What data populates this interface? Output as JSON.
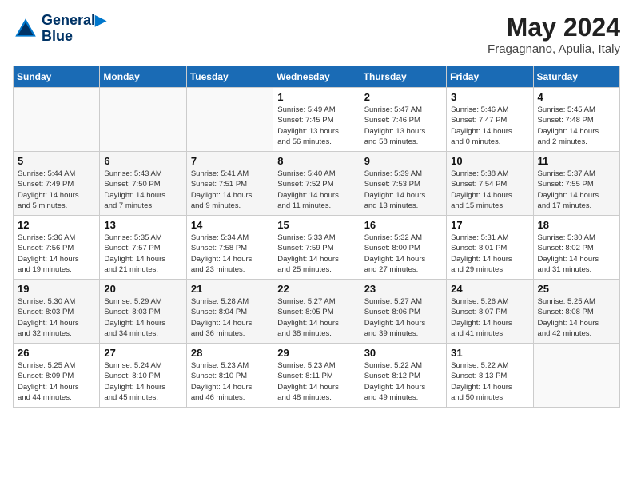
{
  "header": {
    "logo_line1": "General",
    "logo_line2": "Blue",
    "month": "May 2024",
    "location": "Fragagnano, Apulia, Italy"
  },
  "days_of_week": [
    "Sunday",
    "Monday",
    "Tuesday",
    "Wednesday",
    "Thursday",
    "Friday",
    "Saturday"
  ],
  "weeks": [
    [
      {
        "day": "",
        "info": ""
      },
      {
        "day": "",
        "info": ""
      },
      {
        "day": "",
        "info": ""
      },
      {
        "day": "1",
        "info": "Sunrise: 5:49 AM\nSunset: 7:45 PM\nDaylight: 13 hours\nand 56 minutes."
      },
      {
        "day": "2",
        "info": "Sunrise: 5:47 AM\nSunset: 7:46 PM\nDaylight: 13 hours\nand 58 minutes."
      },
      {
        "day": "3",
        "info": "Sunrise: 5:46 AM\nSunset: 7:47 PM\nDaylight: 14 hours\nand 0 minutes."
      },
      {
        "day": "4",
        "info": "Sunrise: 5:45 AM\nSunset: 7:48 PM\nDaylight: 14 hours\nand 2 minutes."
      }
    ],
    [
      {
        "day": "5",
        "info": "Sunrise: 5:44 AM\nSunset: 7:49 PM\nDaylight: 14 hours\nand 5 minutes."
      },
      {
        "day": "6",
        "info": "Sunrise: 5:43 AM\nSunset: 7:50 PM\nDaylight: 14 hours\nand 7 minutes."
      },
      {
        "day": "7",
        "info": "Sunrise: 5:41 AM\nSunset: 7:51 PM\nDaylight: 14 hours\nand 9 minutes."
      },
      {
        "day": "8",
        "info": "Sunrise: 5:40 AM\nSunset: 7:52 PM\nDaylight: 14 hours\nand 11 minutes."
      },
      {
        "day": "9",
        "info": "Sunrise: 5:39 AM\nSunset: 7:53 PM\nDaylight: 14 hours\nand 13 minutes."
      },
      {
        "day": "10",
        "info": "Sunrise: 5:38 AM\nSunset: 7:54 PM\nDaylight: 14 hours\nand 15 minutes."
      },
      {
        "day": "11",
        "info": "Sunrise: 5:37 AM\nSunset: 7:55 PM\nDaylight: 14 hours\nand 17 minutes."
      }
    ],
    [
      {
        "day": "12",
        "info": "Sunrise: 5:36 AM\nSunset: 7:56 PM\nDaylight: 14 hours\nand 19 minutes."
      },
      {
        "day": "13",
        "info": "Sunrise: 5:35 AM\nSunset: 7:57 PM\nDaylight: 14 hours\nand 21 minutes."
      },
      {
        "day": "14",
        "info": "Sunrise: 5:34 AM\nSunset: 7:58 PM\nDaylight: 14 hours\nand 23 minutes."
      },
      {
        "day": "15",
        "info": "Sunrise: 5:33 AM\nSunset: 7:59 PM\nDaylight: 14 hours\nand 25 minutes."
      },
      {
        "day": "16",
        "info": "Sunrise: 5:32 AM\nSunset: 8:00 PM\nDaylight: 14 hours\nand 27 minutes."
      },
      {
        "day": "17",
        "info": "Sunrise: 5:31 AM\nSunset: 8:01 PM\nDaylight: 14 hours\nand 29 minutes."
      },
      {
        "day": "18",
        "info": "Sunrise: 5:30 AM\nSunset: 8:02 PM\nDaylight: 14 hours\nand 31 minutes."
      }
    ],
    [
      {
        "day": "19",
        "info": "Sunrise: 5:30 AM\nSunset: 8:03 PM\nDaylight: 14 hours\nand 32 minutes."
      },
      {
        "day": "20",
        "info": "Sunrise: 5:29 AM\nSunset: 8:03 PM\nDaylight: 14 hours\nand 34 minutes."
      },
      {
        "day": "21",
        "info": "Sunrise: 5:28 AM\nSunset: 8:04 PM\nDaylight: 14 hours\nand 36 minutes."
      },
      {
        "day": "22",
        "info": "Sunrise: 5:27 AM\nSunset: 8:05 PM\nDaylight: 14 hours\nand 38 minutes."
      },
      {
        "day": "23",
        "info": "Sunrise: 5:27 AM\nSunset: 8:06 PM\nDaylight: 14 hours\nand 39 minutes."
      },
      {
        "day": "24",
        "info": "Sunrise: 5:26 AM\nSunset: 8:07 PM\nDaylight: 14 hours\nand 41 minutes."
      },
      {
        "day": "25",
        "info": "Sunrise: 5:25 AM\nSunset: 8:08 PM\nDaylight: 14 hours\nand 42 minutes."
      }
    ],
    [
      {
        "day": "26",
        "info": "Sunrise: 5:25 AM\nSunset: 8:09 PM\nDaylight: 14 hours\nand 44 minutes."
      },
      {
        "day": "27",
        "info": "Sunrise: 5:24 AM\nSunset: 8:10 PM\nDaylight: 14 hours\nand 45 minutes."
      },
      {
        "day": "28",
        "info": "Sunrise: 5:23 AM\nSunset: 8:10 PM\nDaylight: 14 hours\nand 46 minutes."
      },
      {
        "day": "29",
        "info": "Sunrise: 5:23 AM\nSunset: 8:11 PM\nDaylight: 14 hours\nand 48 minutes."
      },
      {
        "day": "30",
        "info": "Sunrise: 5:22 AM\nSunset: 8:12 PM\nDaylight: 14 hours\nand 49 minutes."
      },
      {
        "day": "31",
        "info": "Sunrise: 5:22 AM\nSunset: 8:13 PM\nDaylight: 14 hours\nand 50 minutes."
      },
      {
        "day": "",
        "info": ""
      }
    ]
  ]
}
